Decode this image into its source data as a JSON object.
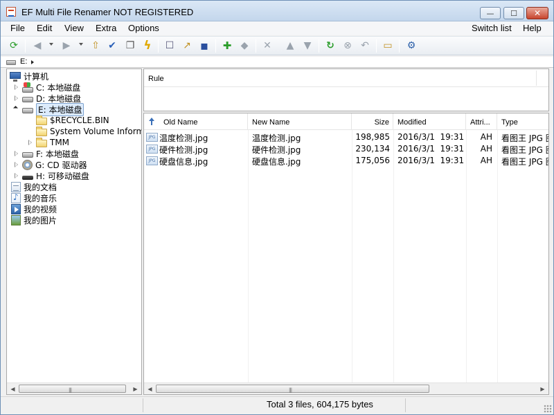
{
  "window": {
    "title": "EF Multi File Renamer NOT REGISTERED",
    "min_glyph": "—",
    "max_glyph": "☐",
    "close_glyph": "✕"
  },
  "menu": {
    "file": "File",
    "edit": "Edit",
    "view": "View",
    "extra": "Extra",
    "options": "Options",
    "switch_list": "Switch list",
    "help": "Help"
  },
  "toolbar": {
    "icons": {
      "refresh": "⟳",
      "back": "◀",
      "forward": "▶",
      "folder_up": "⇧",
      "check": "✔",
      "book": "❐",
      "lightning": "ϟ",
      "new": "☐",
      "open": "↗",
      "save": "▪",
      "add": "✚",
      "edit": "◆",
      "delete": "✕",
      "move_up": "▲",
      "move_down": "▼",
      "apply": "↻",
      "stop": "⊗",
      "undo": "↶",
      "browse": "▭",
      "settings": "⚙"
    },
    "colors": {
      "add": "#2a9d2a",
      "apply": "#2a9d2a",
      "lightning": "#e0a800",
      "disabled": "#9aa3ad",
      "save": "#2a4f9e"
    }
  },
  "path": {
    "text": "E:"
  },
  "tree": {
    "computer": "计算机",
    "drive_c": "C: 本地磁盘",
    "drive_d": "D: 本地磁盘",
    "drive_e": "E: 本地磁盘",
    "folder_recycle": "$RECYCLE.BIN",
    "folder_svi": "System Volume Information",
    "folder_tmm": "TMM",
    "drive_f": "F: 本地磁盘",
    "drive_g": "G: CD 驱动器",
    "drive_h": "H: 可移动磁盘",
    "lib_docs": "我的文档",
    "lib_music": "我的音乐",
    "lib_video": "我的视频",
    "lib_pics": "我的图片"
  },
  "rules": {
    "header": "Rule"
  },
  "files": {
    "columns": {
      "old_name": "Old Name",
      "new_name": "New Name",
      "size": "Size",
      "modified": "Modified",
      "attributes": "Attri...",
      "type": "Type"
    },
    "icon_label": "JPG",
    "rows": [
      {
        "old_name": "温度检测.jpg",
        "new_name": "温度检测.jpg",
        "size": "198,985",
        "modified": "2016/3/1  19:31",
        "attr": "AH",
        "type": "看图王 JPG 图"
      },
      {
        "old_name": "硬件检测.jpg",
        "new_name": "硬件检测.jpg",
        "size": "230,134",
        "modified": "2016/3/1  19:31",
        "attr": "AH",
        "type": "看图王 JPG 图"
      },
      {
        "old_name": "硬盘信息.jpg",
        "new_name": "硬盘信息.jpg",
        "size": "175,056",
        "modified": "2016/3/1  19:31",
        "attr": "AH",
        "type": "看图王 JPG 图"
      }
    ]
  },
  "scroll": {
    "left": "◀",
    "right": "▶",
    "grip": "|||"
  },
  "status": {
    "text": "Total 3 files, 604,175 bytes"
  }
}
